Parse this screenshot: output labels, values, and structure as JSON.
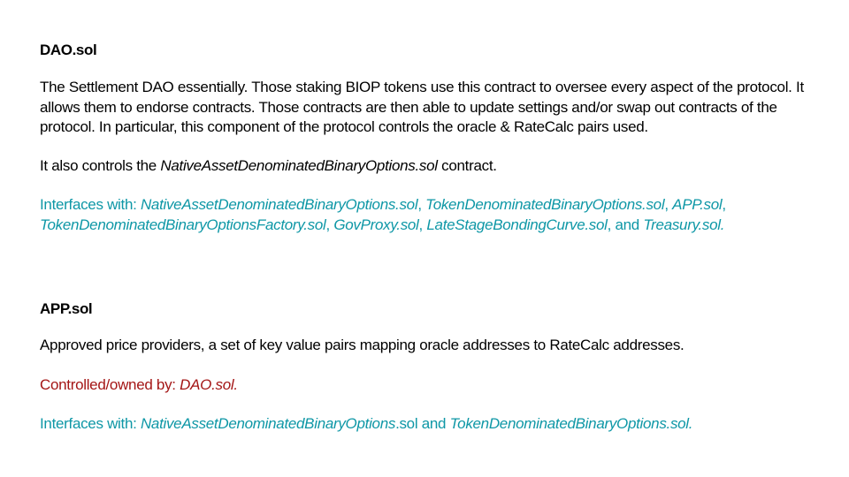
{
  "colors": {
    "interfaces": "#0e97a6",
    "controlled": "#a41616",
    "text": "#000000"
  },
  "dao": {
    "title": "DAO.sol",
    "description": "The Settlement DAO essentially. Those staking BIOP tokens use this contract to oversee every aspect of the protocol. It allows them to endorse contracts. Those contracts are then able to update settings and/or swap out contracts of the protocol. In particular, this component of the protocol controls the oracle & RateCalc pairs used.",
    "also_prefix": "It also controls the ",
    "also_contract": "NativeAssetDenominatedBinaryOptions.sol",
    "also_suffix": " contract.",
    "interfaces_label": "Interfaces with: ",
    "interfaces": {
      "c1": "NativeAssetDenominatedBinaryOptions.sol",
      "c2": "TokenDenominatedBinaryOptions.sol",
      "c3": "APP.sol",
      "c4": "TokenDenominatedBinaryOptionsFactory.sol",
      "c5": "GovProxy.sol",
      "c6": "LateStageBondingCurve.sol",
      "c7": "Treasury.sol."
    },
    "sep": ", ",
    "and": ", and "
  },
  "app": {
    "title": "APP.sol",
    "description": "Approved price providers, a set of key value pairs mapping oracle addresses to RateCalc addresses.",
    "controlled_label": "Controlled/owned by: ",
    "controlled_value": "DAO.sol.",
    "interfaces_label": "Interfaces with: ",
    "iface1_italic": "NativeAssetDenominatedBinaryOptions",
    "iface1_plain": ".sol and ",
    "iface2": "TokenDenominatedBinaryOptions.sol."
  }
}
